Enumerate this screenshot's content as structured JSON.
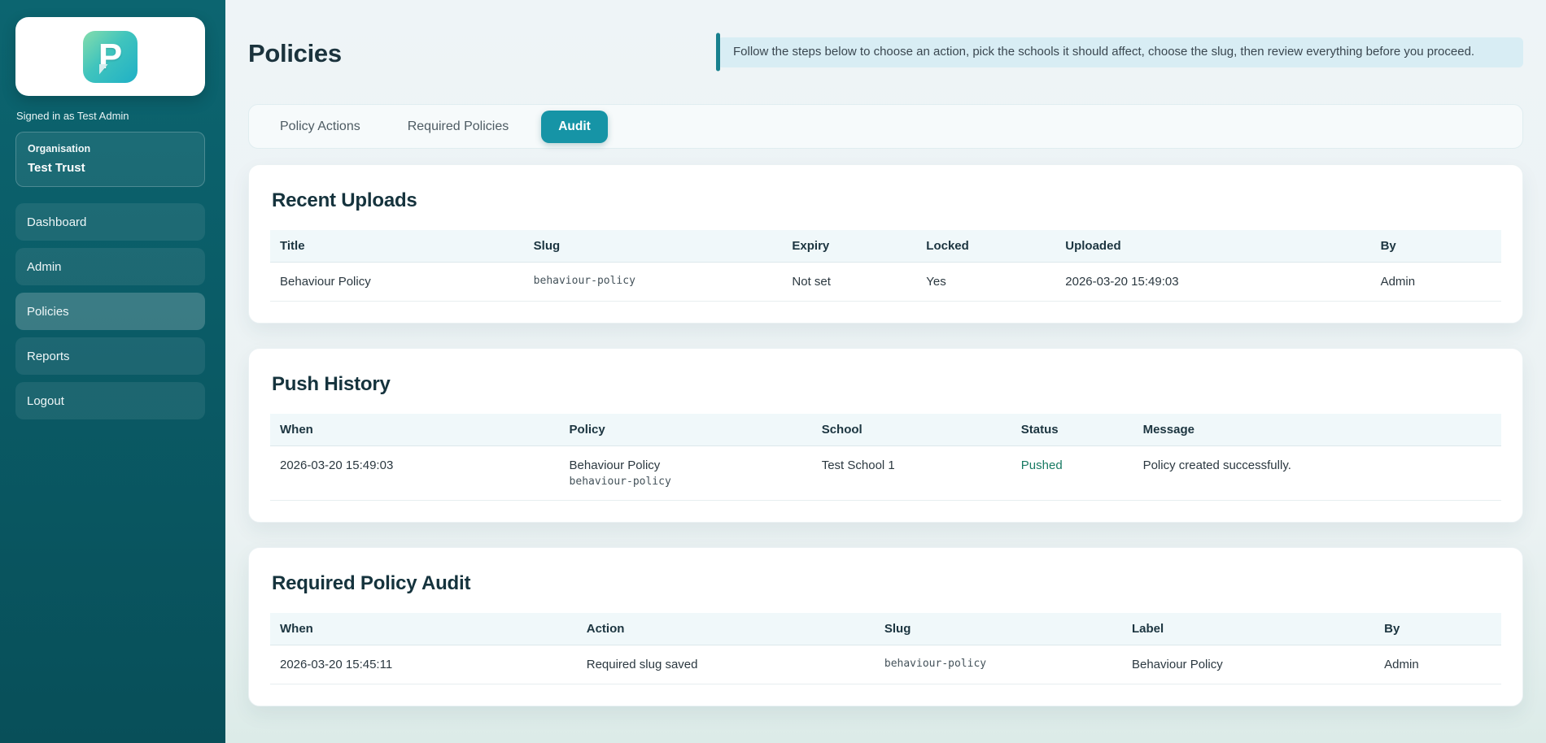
{
  "sidebar": {
    "logo_letter": "P",
    "signed_in": "Signed in as Test Admin",
    "org_label": "Organisation",
    "org_name": "Test Trust",
    "nav": [
      {
        "label": "Dashboard",
        "active": false
      },
      {
        "label": "Admin",
        "active": false
      },
      {
        "label": "Policies",
        "active": true
      },
      {
        "label": "Reports",
        "active": false
      },
      {
        "label": "Logout",
        "active": false
      }
    ]
  },
  "header": {
    "title": "Policies",
    "banner": "Follow the steps below to choose an action, pick the schools it should affect, choose the slug, then review everything before you proceed."
  },
  "tabs": [
    {
      "label": "Policy Actions",
      "active": false
    },
    {
      "label": "Required Policies",
      "active": false
    },
    {
      "label": "Audit",
      "active": true
    }
  ],
  "sections": {
    "recent_uploads": {
      "title": "Recent Uploads",
      "columns": [
        "Title",
        "Slug",
        "Expiry",
        "Locked",
        "Uploaded",
        "By"
      ],
      "rows": [
        {
          "title": "Behaviour Policy",
          "slug": "behaviour-policy",
          "expiry": "Not set",
          "locked": "Yes",
          "uploaded": "2026-03-20 15:49:03",
          "by": "Admin"
        }
      ]
    },
    "push_history": {
      "title": "Push History",
      "columns": [
        "When",
        "Policy",
        "School",
        "Status",
        "Message"
      ],
      "rows": [
        {
          "when": "2026-03-20 15:49:03",
          "policy": "Behaviour Policy",
          "policy_slug": "behaviour-policy",
          "school": "Test School 1",
          "status": "Pushed",
          "message": "Policy created successfully."
        }
      ]
    },
    "required_policy_audit": {
      "title": "Required Policy Audit",
      "columns": [
        "When",
        "Action",
        "Slug",
        "Label",
        "By"
      ],
      "rows": [
        {
          "when": "2026-03-20 15:45:11",
          "action": "Required slug saved",
          "slug": "behaviour-policy",
          "label": "Behaviour Policy",
          "by": "Admin"
        }
      ]
    }
  },
  "colors": {
    "sidebar_teal": "#0b5f6a",
    "accent_teal": "#1694a6",
    "banner_bg": "#d8edf4",
    "banner_accent": "#18808e",
    "status_pushed": "#187a63",
    "main_bg": "#eef4f7"
  }
}
